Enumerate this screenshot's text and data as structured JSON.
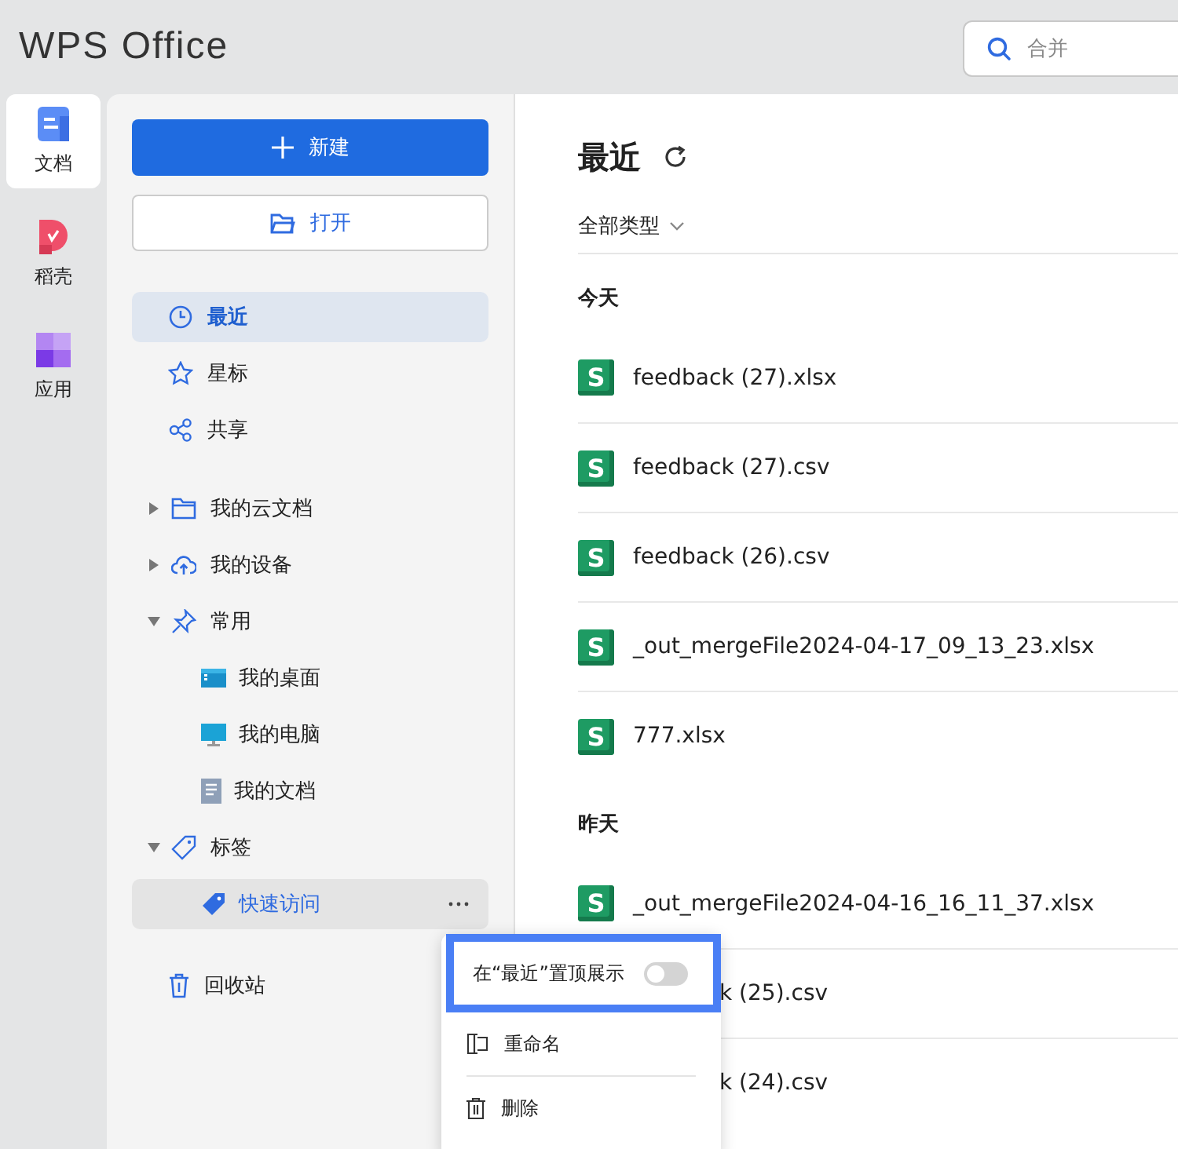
{
  "app_title": "WPS Office",
  "search": {
    "placeholder": "合并"
  },
  "rail": [
    {
      "label": "文档",
      "selected": true
    },
    {
      "label": "稻壳",
      "selected": false
    },
    {
      "label": "应用",
      "selected": false
    }
  ],
  "sidebar": {
    "new_button": "新建",
    "open_button": "打开",
    "nav": [
      {
        "label": "最近",
        "selected": true
      },
      {
        "label": "星标",
        "selected": false
      },
      {
        "label": "共享",
        "selected": false
      }
    ],
    "tree": [
      {
        "label": "我的云文档",
        "expanded": false
      },
      {
        "label": "我的设备",
        "expanded": false
      },
      {
        "label": "常用",
        "expanded": true,
        "children": [
          {
            "label": "我的桌面",
            "selected": false
          },
          {
            "label": "我的电脑",
            "selected": false
          },
          {
            "label": "我的文档",
            "selected": false
          }
        ]
      },
      {
        "label": "标签",
        "expanded": true,
        "children": [
          {
            "label": "快速访问",
            "selected": true
          }
        ]
      }
    ],
    "trash": "回收站"
  },
  "main": {
    "title": "最近",
    "filter": "全部类型",
    "sections": [
      {
        "heading": "今天",
        "files": [
          {
            "type_letter": "S",
            "name": "feedback (27).xlsx"
          },
          {
            "type_letter": "S",
            "name": "feedback (27).csv"
          },
          {
            "type_letter": "S",
            "name": "feedback (26).csv"
          },
          {
            "type_letter": "S",
            "name": "_out_mergeFile2024-04-17_09_13_23.xlsx"
          },
          {
            "type_letter": "S",
            "name": "777.xlsx"
          }
        ]
      },
      {
        "heading": "昨天",
        "files": [
          {
            "type_letter": "S",
            "name": "_out_mergeFile2024-04-16_16_11_37.xlsx"
          },
          {
            "name": "k (25).csv",
            "covered": true
          },
          {
            "name": "k (24).csv",
            "covered": true
          }
        ]
      }
    ]
  },
  "context_menu": {
    "items": [
      {
        "kind": "toggle",
        "label": "在“最近”置顶展示",
        "on": false,
        "selected": true
      },
      {
        "kind": "rename",
        "label": "重命名",
        "selected": false
      },
      {
        "kind": "delete",
        "label": "删除",
        "selected": false
      }
    ]
  }
}
